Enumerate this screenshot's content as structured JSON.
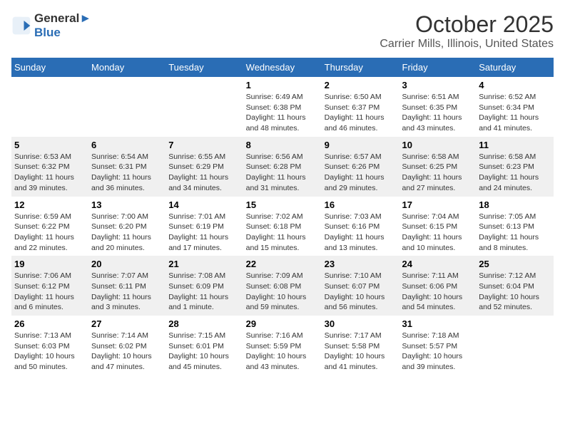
{
  "header": {
    "logo_line1": "General",
    "logo_line2": "Blue",
    "month": "October 2025",
    "location": "Carrier Mills, Illinois, United States"
  },
  "weekdays": [
    "Sunday",
    "Monday",
    "Tuesday",
    "Wednesday",
    "Thursday",
    "Friday",
    "Saturday"
  ],
  "weeks": [
    [
      {
        "day": "",
        "info": ""
      },
      {
        "day": "",
        "info": ""
      },
      {
        "day": "",
        "info": ""
      },
      {
        "day": "1",
        "info": "Sunrise: 6:49 AM\nSunset: 6:38 PM\nDaylight: 11 hours\nand 48 minutes."
      },
      {
        "day": "2",
        "info": "Sunrise: 6:50 AM\nSunset: 6:37 PM\nDaylight: 11 hours\nand 46 minutes."
      },
      {
        "day": "3",
        "info": "Sunrise: 6:51 AM\nSunset: 6:35 PM\nDaylight: 11 hours\nand 43 minutes."
      },
      {
        "day": "4",
        "info": "Sunrise: 6:52 AM\nSunset: 6:34 PM\nDaylight: 11 hours\nand 41 minutes."
      }
    ],
    [
      {
        "day": "5",
        "info": "Sunrise: 6:53 AM\nSunset: 6:32 PM\nDaylight: 11 hours\nand 39 minutes."
      },
      {
        "day": "6",
        "info": "Sunrise: 6:54 AM\nSunset: 6:31 PM\nDaylight: 11 hours\nand 36 minutes."
      },
      {
        "day": "7",
        "info": "Sunrise: 6:55 AM\nSunset: 6:29 PM\nDaylight: 11 hours\nand 34 minutes."
      },
      {
        "day": "8",
        "info": "Sunrise: 6:56 AM\nSunset: 6:28 PM\nDaylight: 11 hours\nand 31 minutes."
      },
      {
        "day": "9",
        "info": "Sunrise: 6:57 AM\nSunset: 6:26 PM\nDaylight: 11 hours\nand 29 minutes."
      },
      {
        "day": "10",
        "info": "Sunrise: 6:58 AM\nSunset: 6:25 PM\nDaylight: 11 hours\nand 27 minutes."
      },
      {
        "day": "11",
        "info": "Sunrise: 6:58 AM\nSunset: 6:23 PM\nDaylight: 11 hours\nand 24 minutes."
      }
    ],
    [
      {
        "day": "12",
        "info": "Sunrise: 6:59 AM\nSunset: 6:22 PM\nDaylight: 11 hours\nand 22 minutes."
      },
      {
        "day": "13",
        "info": "Sunrise: 7:00 AM\nSunset: 6:20 PM\nDaylight: 11 hours\nand 20 minutes."
      },
      {
        "day": "14",
        "info": "Sunrise: 7:01 AM\nSunset: 6:19 PM\nDaylight: 11 hours\nand 17 minutes."
      },
      {
        "day": "15",
        "info": "Sunrise: 7:02 AM\nSunset: 6:18 PM\nDaylight: 11 hours\nand 15 minutes."
      },
      {
        "day": "16",
        "info": "Sunrise: 7:03 AM\nSunset: 6:16 PM\nDaylight: 11 hours\nand 13 minutes."
      },
      {
        "day": "17",
        "info": "Sunrise: 7:04 AM\nSunset: 6:15 PM\nDaylight: 11 hours\nand 10 minutes."
      },
      {
        "day": "18",
        "info": "Sunrise: 7:05 AM\nSunset: 6:13 PM\nDaylight: 11 hours\nand 8 minutes."
      }
    ],
    [
      {
        "day": "19",
        "info": "Sunrise: 7:06 AM\nSunset: 6:12 PM\nDaylight: 11 hours\nand 6 minutes."
      },
      {
        "day": "20",
        "info": "Sunrise: 7:07 AM\nSunset: 6:11 PM\nDaylight: 11 hours\nand 3 minutes."
      },
      {
        "day": "21",
        "info": "Sunrise: 7:08 AM\nSunset: 6:09 PM\nDaylight: 11 hours\nand 1 minute."
      },
      {
        "day": "22",
        "info": "Sunrise: 7:09 AM\nSunset: 6:08 PM\nDaylight: 10 hours\nand 59 minutes."
      },
      {
        "day": "23",
        "info": "Sunrise: 7:10 AM\nSunset: 6:07 PM\nDaylight: 10 hours\nand 56 minutes."
      },
      {
        "day": "24",
        "info": "Sunrise: 7:11 AM\nSunset: 6:06 PM\nDaylight: 10 hours\nand 54 minutes."
      },
      {
        "day": "25",
        "info": "Sunrise: 7:12 AM\nSunset: 6:04 PM\nDaylight: 10 hours\nand 52 minutes."
      }
    ],
    [
      {
        "day": "26",
        "info": "Sunrise: 7:13 AM\nSunset: 6:03 PM\nDaylight: 10 hours\nand 50 minutes."
      },
      {
        "day": "27",
        "info": "Sunrise: 7:14 AM\nSunset: 6:02 PM\nDaylight: 10 hours\nand 47 minutes."
      },
      {
        "day": "28",
        "info": "Sunrise: 7:15 AM\nSunset: 6:01 PM\nDaylight: 10 hours\nand 45 minutes."
      },
      {
        "day": "29",
        "info": "Sunrise: 7:16 AM\nSunset: 5:59 PM\nDaylight: 10 hours\nand 43 minutes."
      },
      {
        "day": "30",
        "info": "Sunrise: 7:17 AM\nSunset: 5:58 PM\nDaylight: 10 hours\nand 41 minutes."
      },
      {
        "day": "31",
        "info": "Sunrise: 7:18 AM\nSunset: 5:57 PM\nDaylight: 10 hours\nand 39 minutes."
      },
      {
        "day": "",
        "info": ""
      }
    ]
  ]
}
